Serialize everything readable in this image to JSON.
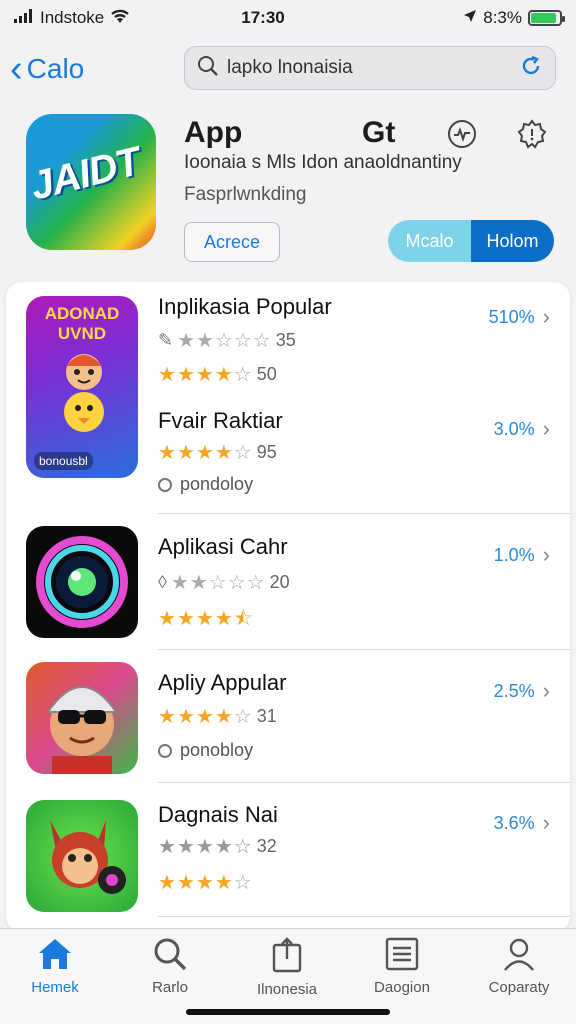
{
  "status_bar": {
    "carrier": "Indstoke",
    "time": "17:30",
    "battery": "8:3%",
    "battery_level": 0.9
  },
  "nav": {
    "back_label": "Calo",
    "search_placeholder": "lapko lnonaisia"
  },
  "app": {
    "logo_text": "JAIDT",
    "title": "App",
    "title_2": "Gt",
    "subtitle": "Ioonaia s Mls  Idon anaoldnantiny",
    "caption": "Fasprlwnkding",
    "secondary_button": "Acrece",
    "primary_button_left": "Mcalo",
    "primary_button_right": "Holom"
  },
  "list": [
    {
      "title": "Inplikasia Popular",
      "percent": "510%",
      "rating_count": "35",
      "rating_stars": 2.5,
      "sub_rating_count": "50",
      "sub_rating_stars": 4,
      "icon_text_top": "ADONAD",
      "icon_text_mid": "UVND",
      "icon_text_bottom": "bonousbl"
    },
    {
      "title": "Fvair Raktiar",
      "percent": "3.0%",
      "rating_count": "95",
      "rating_stars": 4,
      "meta": "pondoloy"
    },
    {
      "title": "Aplikasi Cahr",
      "percent": "1.0%",
      "rating_count": "20",
      "rating_stars": 2,
      "sub_rating_stars": 4.5
    },
    {
      "title": "Apliy Appular",
      "percent": "2.5%",
      "rating_count": "31",
      "rating_stars": 4,
      "meta": "ponobloy"
    },
    {
      "title": "Dagnais Nai",
      "percent": "3.6%",
      "rating_count": "32",
      "rating_stars": 4,
      "sub_rating_stars": 4
    }
  ],
  "tabs": [
    {
      "label": "Hemek",
      "icon": "home-icon",
      "active": true
    },
    {
      "label": "Rarlo",
      "icon": "search-icon",
      "active": false
    },
    {
      "label": "Ilnonesia",
      "icon": "share-icon",
      "active": false
    },
    {
      "label": "Daogion",
      "icon": "list-icon",
      "active": false
    },
    {
      "label": "Coparaty",
      "icon": "person-icon",
      "active": false
    }
  ],
  "colors": {
    "accent": "#1a7ae0",
    "star": "#f5a623",
    "percent": "#2a8ad6"
  }
}
